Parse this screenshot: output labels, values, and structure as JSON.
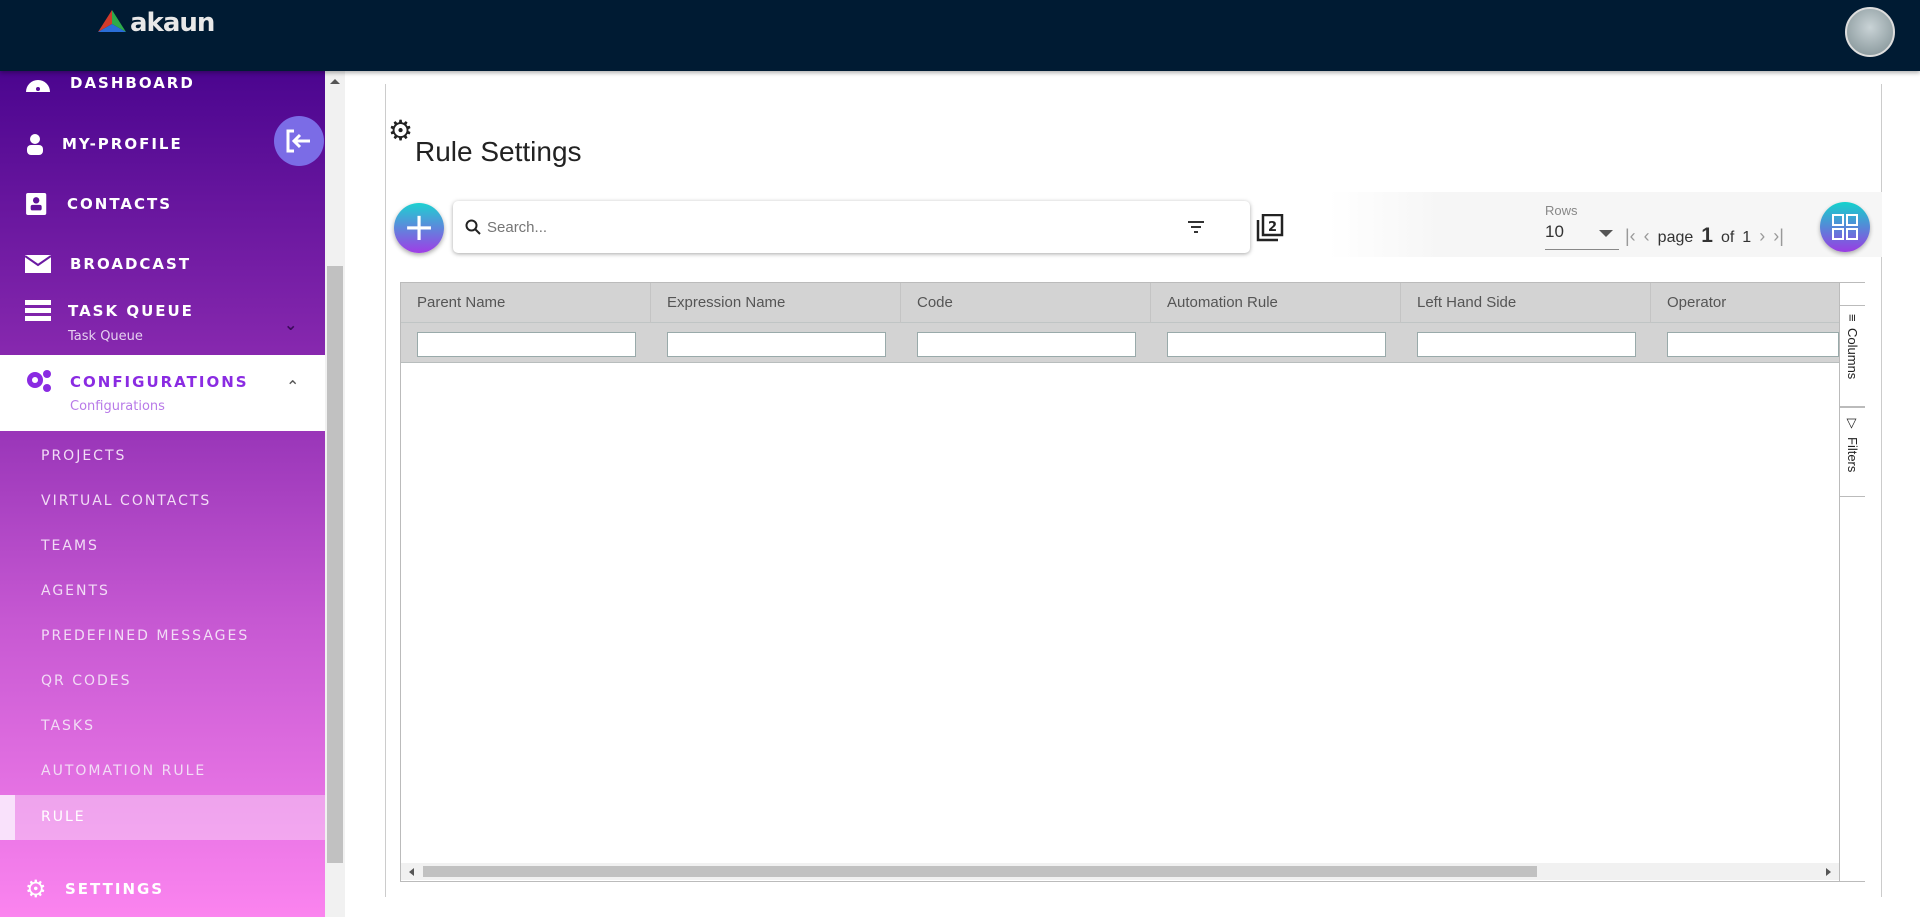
{
  "header": {
    "logo_text": "akaun"
  },
  "sidebar": {
    "items": [
      {
        "label": "DASHBOARD",
        "icon": "dashboard-icon"
      },
      {
        "label": "MY-PROFILE",
        "icon": "user-icon"
      },
      {
        "label": "CONTACTS",
        "icon": "contacts-icon"
      },
      {
        "label": "BROADCAST",
        "icon": "envelope-icon"
      },
      {
        "label": "TASK QUEUE",
        "sublabel": "Task Queue",
        "icon": "server-icon"
      },
      {
        "label": "CONFIGURATIONS",
        "sublabel": "Configurations",
        "icon": "gears-icon"
      }
    ],
    "subitems": [
      "PROJECTS",
      "VIRTUAL CONTACTS",
      "TEAMS",
      "AGENTS",
      "PREDEFINED MESSAGES",
      "QR CODES",
      "TASKS",
      "AUTOMATION RULE",
      "RULE"
    ],
    "active_subitem": "RULE",
    "settings_label": "SETTINGS"
  },
  "main": {
    "title": "Rule Settings",
    "search": {
      "placeholder": "Search...",
      "value": ""
    },
    "pagination": {
      "rows_label": "Rows",
      "rows_value": "10",
      "page_word": "page",
      "page": "1",
      "of_word": "of",
      "total_pages": "1"
    },
    "grid": {
      "columns": [
        "Parent Name",
        "Expression Name",
        "Code",
        "Automation Rule",
        "Left Hand Side",
        "Operator"
      ],
      "side_tabs": [
        "Columns",
        "Filters"
      ]
    }
  },
  "colors": {
    "topbar": "#001b33",
    "accent": "#8a2be2"
  }
}
